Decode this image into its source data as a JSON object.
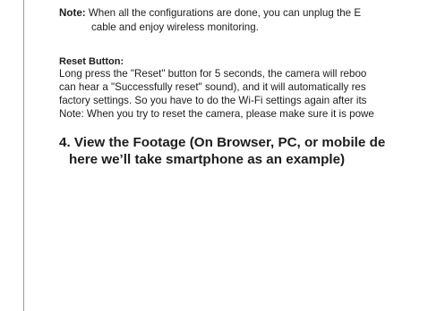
{
  "note": {
    "label": "Note:",
    "text": " When all the configurations are done, you can unplug the E",
    "continuation": "cable and enjoy wireless monitoring."
  },
  "reset": {
    "heading": "Reset Button:",
    "lines": [
      "Long press the \"Reset\" button for 5 seconds, the camera will reboo",
      "can hear a \"Successfully reset\" sound), and it will automatically res",
      "factory settings. So you have to do the Wi-Fi settings again after its",
      "Note: When you try to reset the camera, please make sure it is powe"
    ]
  },
  "section": {
    "heading_line1": "4. View the Footage (On Browser, PC, or mobile de",
    "heading_line2": "here we’ll take smartphone as an example)"
  }
}
